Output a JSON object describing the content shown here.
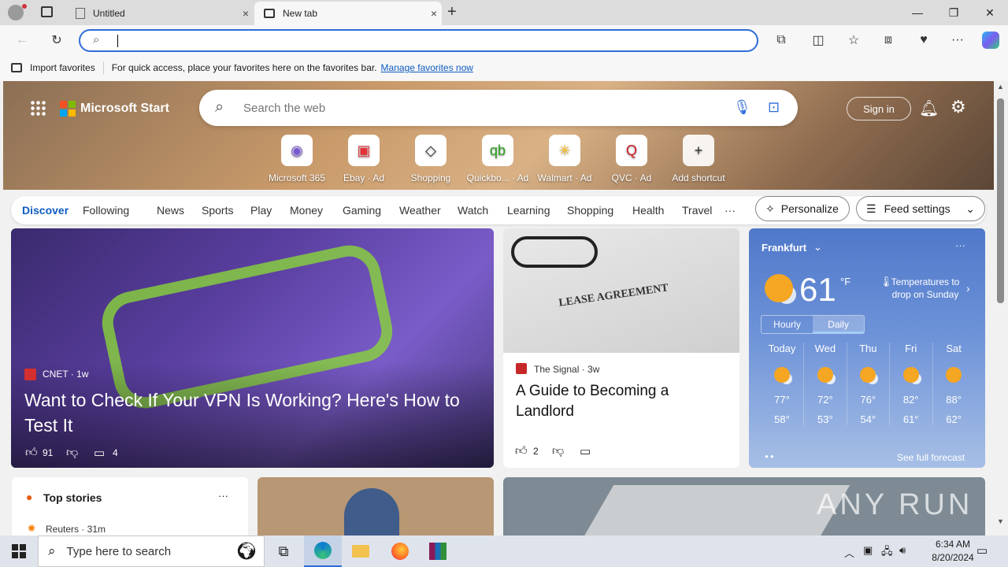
{
  "tabs": [
    {
      "title": "Untitled",
      "close": "×"
    },
    {
      "title": "New tab",
      "close": "×"
    }
  ],
  "new_tab_icon": "+",
  "window": {
    "minimize": "—",
    "maximize": "❐",
    "close": "✕"
  },
  "favorites_bar": {
    "import_label": "Import favorites",
    "hint": "For quick access, place your favorites here on the favorites bar.",
    "manage_link": "Manage favorites now"
  },
  "hero": {
    "brand": "Microsoft Start",
    "search_placeholder": "Search the web",
    "sign_in": "Sign in"
  },
  "shortcuts": [
    {
      "label": "Microsoft 365",
      "icon": "◉",
      "color": "#7b5cd6"
    },
    {
      "label": "Ebay · Ad",
      "icon": "▣",
      "color": "#e53238"
    },
    {
      "label": "Shopping",
      "icon": "◇",
      "color": "#333333"
    },
    {
      "label": "Quickbo... · Ad",
      "icon": "qb",
      "color": "#2ca01c"
    },
    {
      "label": "Walmart · Ad",
      "icon": "✳",
      "color": "#ffc220"
    },
    {
      "label": "QVC · Ad",
      "icon": "Q",
      "color": "#d21f2a"
    },
    {
      "label": "Add shortcut",
      "icon": "+",
      "color": "#ffffff"
    }
  ],
  "nav": {
    "items": [
      "Discover",
      "Following",
      "News",
      "Sports",
      "Play",
      "Money",
      "Gaming",
      "Weather",
      "Watch",
      "Learning",
      "Shopping",
      "Health",
      "Travel",
      "···"
    ],
    "personalize": "Personalize",
    "feed_settings": "Feed settings"
  },
  "card1": {
    "source": "CNET · 1w",
    "title": "Want to Check If Your VPN Is Working? Here's How to Test It",
    "likes": "91",
    "comments": "4"
  },
  "card2": {
    "image_title": "LEASE AGREEMENT",
    "source": "The Signal · 3w",
    "title": "A Guide to Becoming a Landlord",
    "likes": "2"
  },
  "weather": {
    "city": "Frankfurt",
    "temp": "61",
    "unit": "°F",
    "alert": "Temperatures to drop on Sunday",
    "tabs": [
      "Hourly",
      "Daily"
    ],
    "days": [
      {
        "day": "Today",
        "hi": "77°",
        "lo": "58°"
      },
      {
        "day": "Wed",
        "hi": "72°",
        "lo": "53°"
      },
      {
        "day": "Thu",
        "hi": "76°",
        "lo": "54°"
      },
      {
        "day": "Fri",
        "hi": "82°",
        "lo": "61°"
      },
      {
        "day": "Sat",
        "hi": "88°",
        "lo": "62°"
      }
    ],
    "see_full": "See full forecast"
  },
  "top_stories": {
    "title": "Top stories",
    "source": "Reuters · 31m"
  },
  "watermark": "ANY RUN",
  "taskbar": {
    "search_placeholder": "Type here to search",
    "time": "6:34 AM",
    "date": "8/20/2024"
  },
  "colors": {
    "accent": "#2f6dd9",
    "weather_bg": "#4f78c9"
  }
}
